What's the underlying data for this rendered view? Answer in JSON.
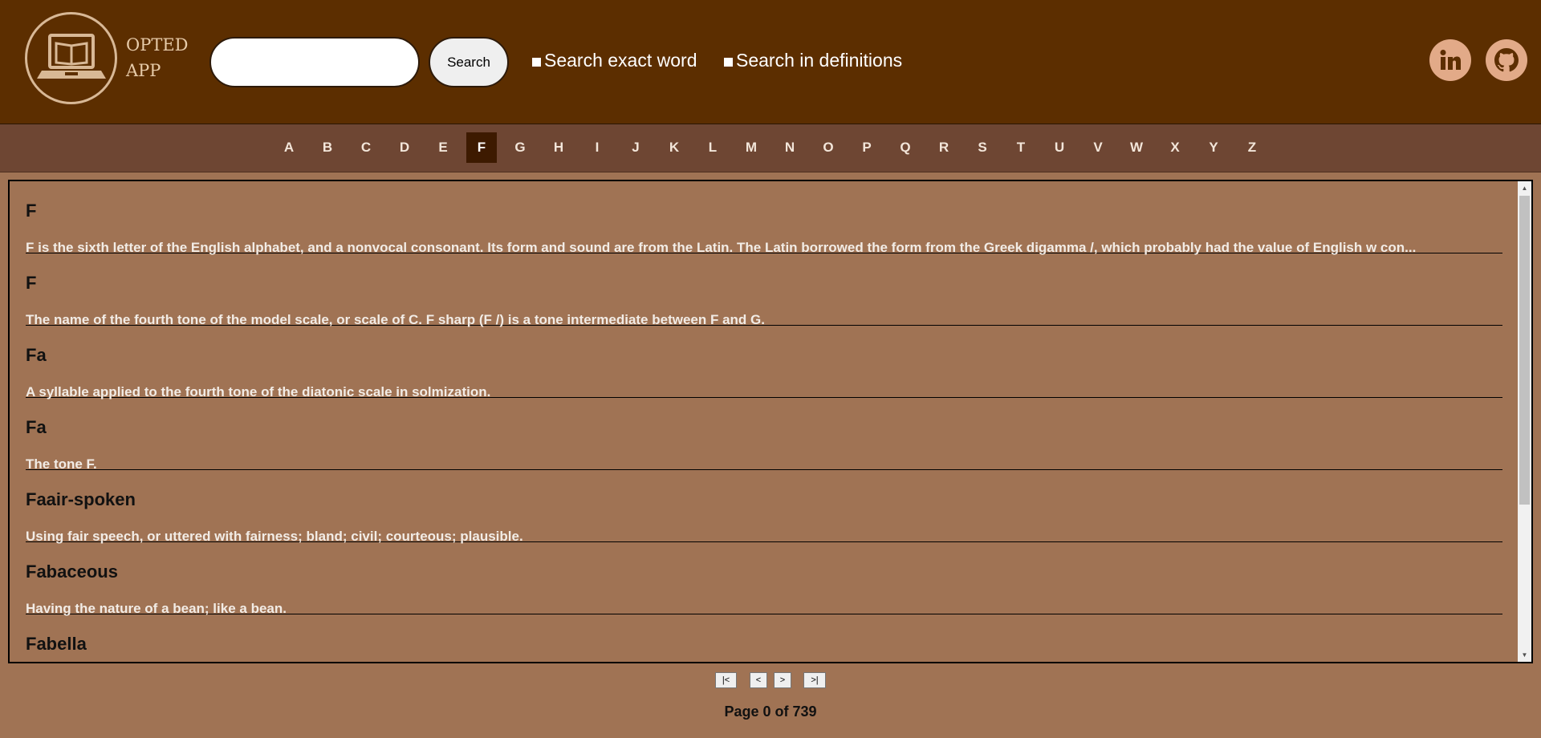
{
  "header": {
    "logo_line1": "OPTED",
    "logo_line2": "APP",
    "search_placeholder": "",
    "search_value": "",
    "search_button_label": "Search",
    "exact_word_label": "Search exact word",
    "in_definitions_label": "Search in definitions",
    "linkedin_icon": "linkedin-icon",
    "github_icon": "github-icon"
  },
  "alphabet": {
    "letters": [
      "A",
      "B",
      "C",
      "D",
      "E",
      "F",
      "G",
      "H",
      "I",
      "J",
      "K",
      "L",
      "M",
      "N",
      "O",
      "P",
      "Q",
      "R",
      "S",
      "T",
      "U",
      "V",
      "W",
      "X",
      "Y",
      "Z"
    ],
    "active": "F"
  },
  "entries": [
    {
      "word": "F",
      "definition": "F is the sixth letter of the English alphabet, and a nonvocal consonant. Its form and sound are from the Latin. The Latin borrowed the form from the Greek digamma /, which probably had the value of English w con..."
    },
    {
      "word": "F",
      "definition": "The name of the fourth tone of the model scale, or scale of C. F sharp (F /) is a tone intermediate between F and G."
    },
    {
      "word": "Fa",
      "definition": "A syllable applied to the fourth tone of the diatonic scale in solmization."
    },
    {
      "word": "Fa",
      "definition": "The tone F."
    },
    {
      "word": "Faair-spoken",
      "definition": "Using fair speech, or uttered with fairness; bland; civil; courteous; plausible."
    },
    {
      "word": "Fabaceous",
      "definition": "Having the nature of a bean; like a bean."
    },
    {
      "word": "Fabella",
      "definition": ""
    }
  ],
  "pagination": {
    "first_label": "|<",
    "prev_label": "<",
    "next_label": ">",
    "last_label": ">|",
    "page_text": "Page 0 of 739"
  },
  "colors": {
    "header_bg": "#5c2e00",
    "alpha_bar_bg": "#6e4633",
    "content_bg": "#a07354",
    "active_letter_bg": "#3d1a00",
    "social_icon_bg": "#e2aa88"
  }
}
